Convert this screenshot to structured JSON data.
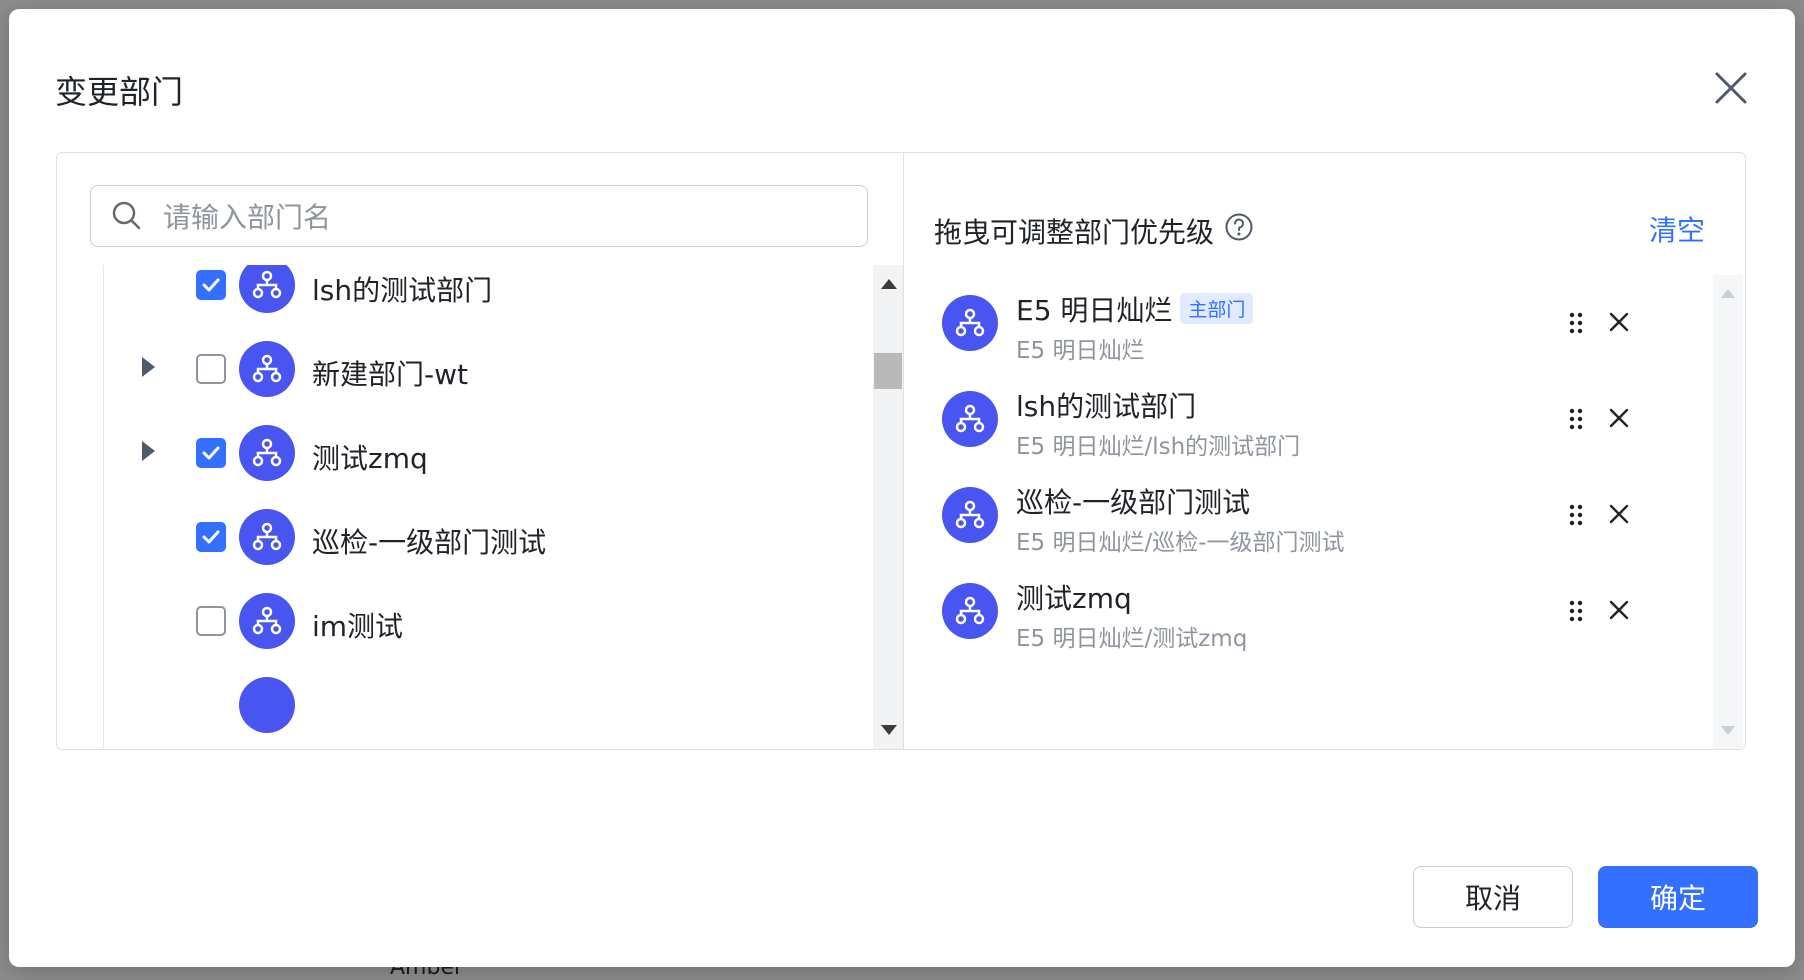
{
  "dialog": {
    "title": "变更部门",
    "cancel_label": "取消",
    "confirm_label": "确定"
  },
  "search": {
    "placeholder": "请输入部门名",
    "value": ""
  },
  "tree": {
    "items": [
      {
        "label": "lsh的测试部门",
        "checked": true,
        "expandable": false
      },
      {
        "label": "新建部门-wt",
        "checked": false,
        "expandable": true
      },
      {
        "label": "测试zmq",
        "checked": true,
        "expandable": true
      },
      {
        "label": "巡检-一级部门测试",
        "checked": true,
        "expandable": false
      },
      {
        "label": "im测试",
        "checked": false,
        "expandable": false
      }
    ]
  },
  "selected": {
    "title": "拖曳可调整部门优先级",
    "clear_label": "清空",
    "items": [
      {
        "name": "E5 明日灿烂",
        "badge": "主部门",
        "path": "E5 明日灿烂"
      },
      {
        "name": "lsh的测试部门",
        "path": "E5 明日灿烂/lsh的测试部门"
      },
      {
        "name": "巡检-一级部门测试",
        "path": "E5 明日灿烂/巡检-一级部门测试"
      },
      {
        "name": "测试zmq",
        "path": "E5 明日灿烂/测试zmq"
      }
    ]
  },
  "background": {
    "bottom_text": "Amber"
  },
  "colors": {
    "primary": "#3370ff",
    "dept_avatar": "#4955f0",
    "badge_bg": "#e1eaff",
    "muted_text": "#8f959e"
  }
}
